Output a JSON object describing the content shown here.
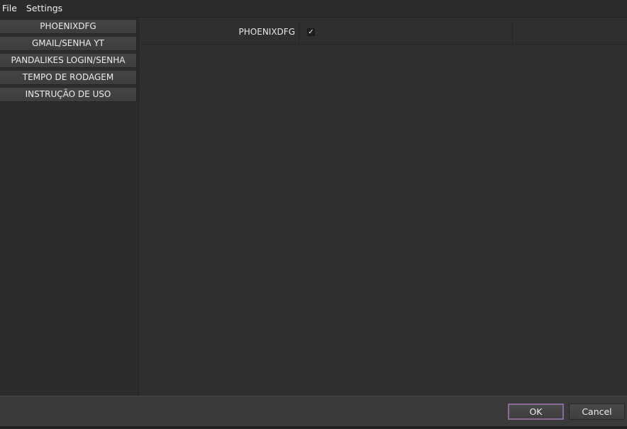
{
  "menubar": {
    "items": [
      "File",
      "Settings"
    ]
  },
  "sidebar": {
    "items": [
      {
        "label": "PHOENIXDFG"
      },
      {
        "label": "GMAIL/SENHA YT"
      },
      {
        "label": "PANDALIKES LOGIN/SENHA"
      },
      {
        "label": "TEMPO DE RODAGEM"
      },
      {
        "label": "INSTRUÇÃO DE USO"
      }
    ]
  },
  "content": {
    "row": {
      "label": "PHOENIXDFG",
      "checked": true,
      "check_glyph": "✓"
    }
  },
  "buttons": {
    "ok": "OK",
    "cancel": "Cancel"
  },
  "colors": {
    "ok_border": "#8a6a9a"
  }
}
